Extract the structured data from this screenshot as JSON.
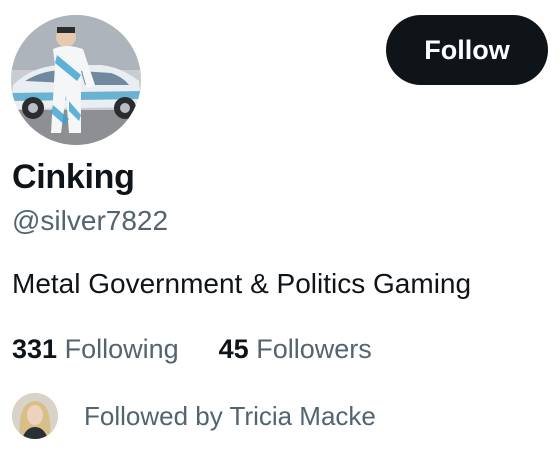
{
  "profile": {
    "display_name": "Cinking",
    "handle": "@silver7822",
    "bio": "Metal Government & Politics Gaming",
    "avatar_icon": "profile-photo"
  },
  "actions": {
    "follow_label": "Follow"
  },
  "stats": {
    "following_count": "331",
    "following_label": "Following",
    "followers_count": "45",
    "followers_label": "Followers"
  },
  "followed_by": {
    "text": "Followed by Tricia Macke",
    "avatar_icon": "follower-photo"
  },
  "colors": {
    "text_primary": "#0f1419",
    "text_secondary": "#536471",
    "button_bg": "#0f1419",
    "button_text": "#ffffff"
  }
}
